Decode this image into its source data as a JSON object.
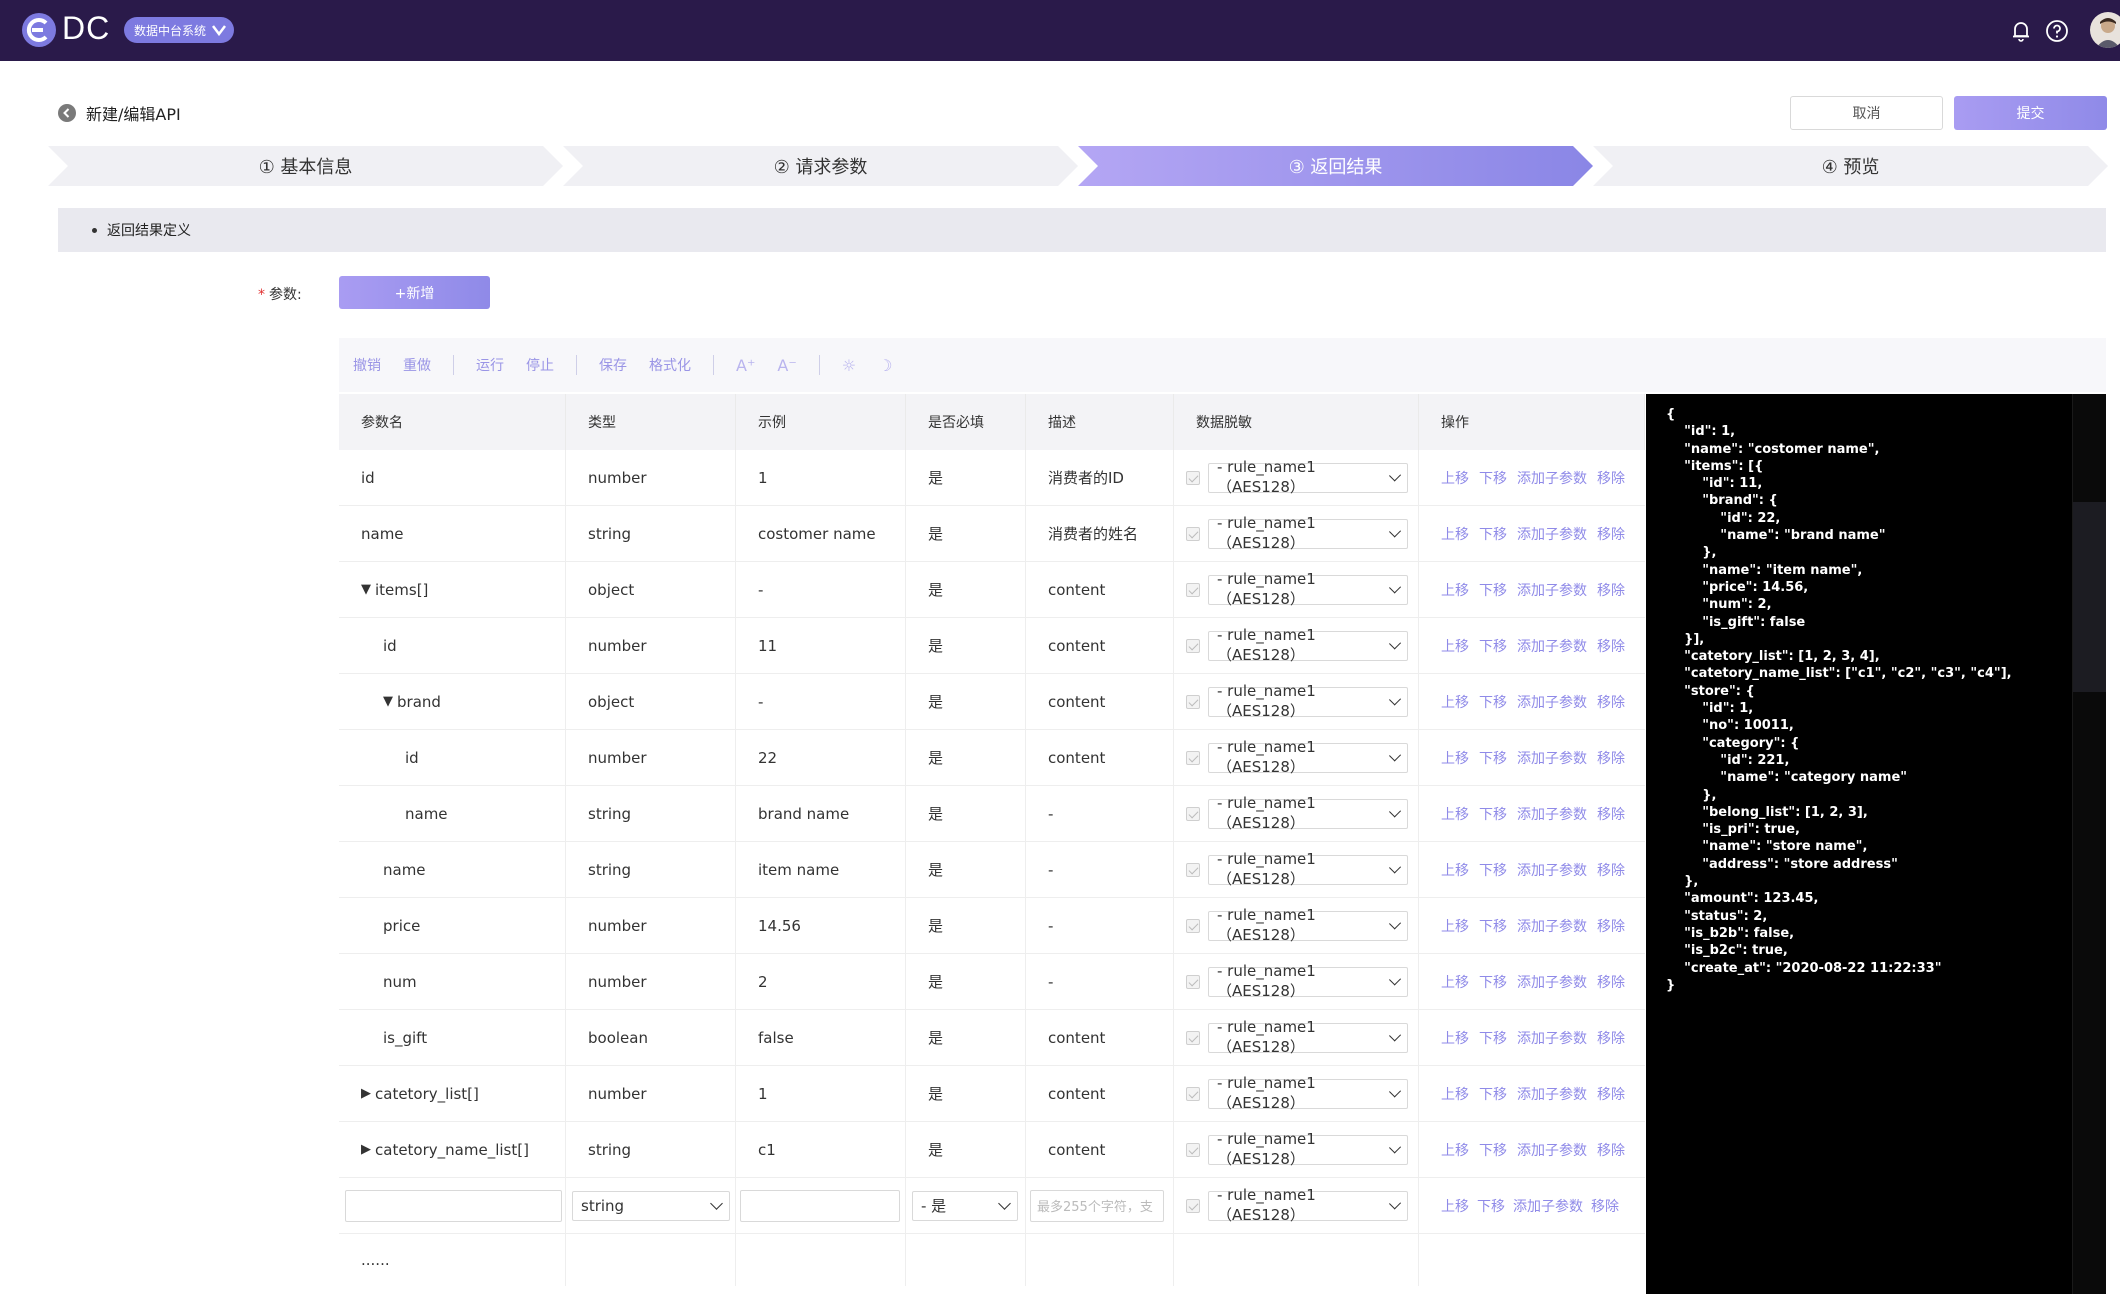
{
  "header": {
    "logo_text": "DC",
    "system_badge": "数据中台系统"
  },
  "page": {
    "title": "新建/编辑API",
    "cancel_label": "取消",
    "submit_label": "提交"
  },
  "steps": [
    "① 基本信息",
    "② 请求参数",
    "③ 返回结果",
    "④ 预览"
  ],
  "active_step": 2,
  "section": {
    "title": "返回结果定义",
    "param_label": "参数:",
    "add_button": "+新增"
  },
  "toolbar": {
    "undo": "撤销",
    "redo": "重做",
    "run": "运行",
    "stop": "停止",
    "save": "保存",
    "format": "格式化"
  },
  "table": {
    "columns": [
      "参数名",
      "类型",
      "示例",
      "是否必填",
      "描述",
      "数据脱敏",
      "操作"
    ],
    "ops": [
      "上移",
      "下移",
      "添加子参数",
      "移除"
    ],
    "mask_value": "- rule_name1（AES128）",
    "rows": [
      {
        "name": "id",
        "indent": 0,
        "caret": "",
        "type": "number",
        "example": "1",
        "required": "是",
        "desc": "消费者的ID"
      },
      {
        "name": "name",
        "indent": 0,
        "caret": "",
        "type": "string",
        "example": "costomer name",
        "required": "是",
        "desc": "消费者的姓名"
      },
      {
        "name": "items[]",
        "indent": 0,
        "caret": "▼",
        "type": "object",
        "example": "-",
        "required": "是",
        "desc": "content"
      },
      {
        "name": "id",
        "indent": 1,
        "caret": "",
        "type": "number",
        "example": "11",
        "required": "是",
        "desc": "content"
      },
      {
        "name": "brand",
        "indent": 1,
        "caret": "▼",
        "type": "object",
        "example": "-",
        "required": "是",
        "desc": "content"
      },
      {
        "name": "id",
        "indent": 2,
        "caret": "",
        "type": "number",
        "example": "22",
        "required": "是",
        "desc": "content"
      },
      {
        "name": "name",
        "indent": 2,
        "caret": "",
        "type": "string",
        "example": "brand name",
        "required": "是",
        "desc": "-"
      },
      {
        "name": "name",
        "indent": 1,
        "caret": "",
        "type": "string",
        "example": "item name",
        "required": "是",
        "desc": "-"
      },
      {
        "name": "price",
        "indent": 1,
        "caret": "",
        "type": "number",
        "example": "14.56",
        "required": "是",
        "desc": "-"
      },
      {
        "name": "num",
        "indent": 1,
        "caret": "",
        "type": "number",
        "example": "2",
        "required": "是",
        "desc": "-"
      },
      {
        "name": "is_gift",
        "indent": 1,
        "caret": "",
        "type": "boolean",
        "example": "false",
        "required": "是",
        "desc": "content"
      },
      {
        "name": "catetory_list[]",
        "indent": 0,
        "caret": "▶",
        "type": "number",
        "example": "1",
        "required": "是",
        "desc": "content"
      },
      {
        "name": "catetory_name_list[]",
        "indent": 0,
        "caret": "▶",
        "type": "string",
        "example": "c1",
        "required": "是",
        "desc": "content"
      }
    ],
    "edit_row": {
      "type_value": "string",
      "required_value": "- 是",
      "desc_placeholder": "最多255个字符，支"
    },
    "more": "......"
  },
  "json_preview": "{\n    \"id\": 1,\n    \"name\": \"costomer name\",\n    \"items\": [{\n        \"id\": 11,\n        \"brand\": {\n            \"id\": 22,\n            \"name\": \"brand name\"\n        },\n        \"name\": \"item name\",\n        \"price\": 14.56,\n        \"num\": 2,\n        \"is_gift\": false\n    }],\n    \"catetory_list\": [1, 2, 3, 4],\n    \"catetory_name_list\": [\"c1\", \"c2\", \"c3\", \"c4\"],\n    \"store\": {\n        \"id\": 1,\n        \"no\": 10011,\n        \"category\": {\n            \"id\": 221,\n            \"name\": \"category name\"\n        },\n        \"belong_list\": [1, 2, 3],\n        \"is_pri\": true,\n        \"name\": \"store name\",\n        \"address\": \"store address\"\n    },\n    \"amount\": 123.45,\n    \"status\": 2,\n    \"is_b2b\": false,\n    \"is_b2c\": true,\n    \"create_at\": \"2020-08-22 11:22:33\"\n}",
  "colors": {
    "topbar": "#2a1a4a",
    "accent": "#8f8ae8",
    "link": "#8f8ae8"
  }
}
